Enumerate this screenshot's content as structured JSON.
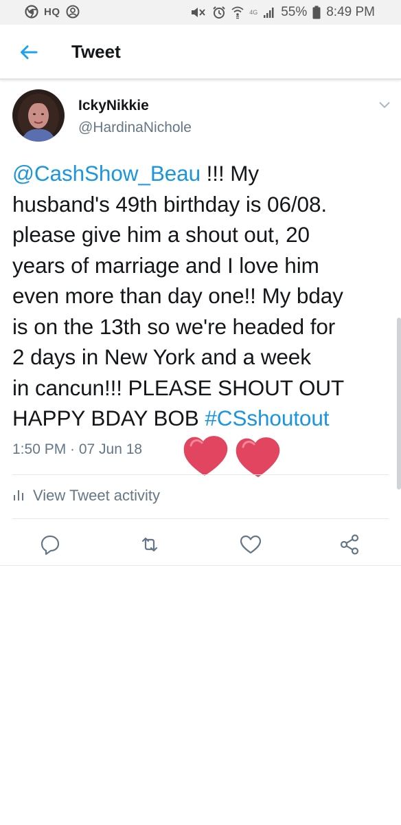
{
  "status_bar": {
    "carrier_badge": "HQ",
    "network_label": "4G",
    "battery_percent": "55%",
    "time": "8:49 PM"
  },
  "header": {
    "title": "Tweet",
    "back_icon": "arrow-left-icon"
  },
  "tweet": {
    "display_name": "IckyNikkie",
    "handle": "@HardinaNichole",
    "text_lines": [
      [
        {
          "t": "@CashShow_Beau",
          "link": true
        },
        {
          "t": " !!! My"
        }
      ],
      [
        {
          "t": "husband's 49th birthday is 06/08."
        }
      ],
      [
        {
          "t": "please give him a shout out, 20"
        }
      ],
      [
        {
          "t": "years of marriage and I love him"
        }
      ],
      [
        {
          "t": "even more than day one!! My bday"
        }
      ],
      [
        {
          "t": "is on the 13th so we're headed for"
        }
      ],
      [
        {
          "t": "2 days in New York and a week"
        }
      ],
      [
        {
          "t": "in cancun!!! PLEASE SHOUT OUT"
        }
      ],
      [
        {
          "t": "HAPPY BDAY BOB "
        },
        {
          "t": "#CSshoutout",
          "link": true
        }
      ]
    ],
    "timestamp": "1:50 PM · 07 Jun 18",
    "activity_label": "View Tweet activity"
  },
  "actions": {
    "reply_icon": "reply-icon",
    "retweet_icon": "retweet-icon",
    "like_icon": "heart-icon",
    "share_icon": "share-icon"
  },
  "colors": {
    "accent": "#1da1f2",
    "link": "#1b95e0",
    "secondary_text": "#657786",
    "heart_sticker": "#e2455f"
  }
}
